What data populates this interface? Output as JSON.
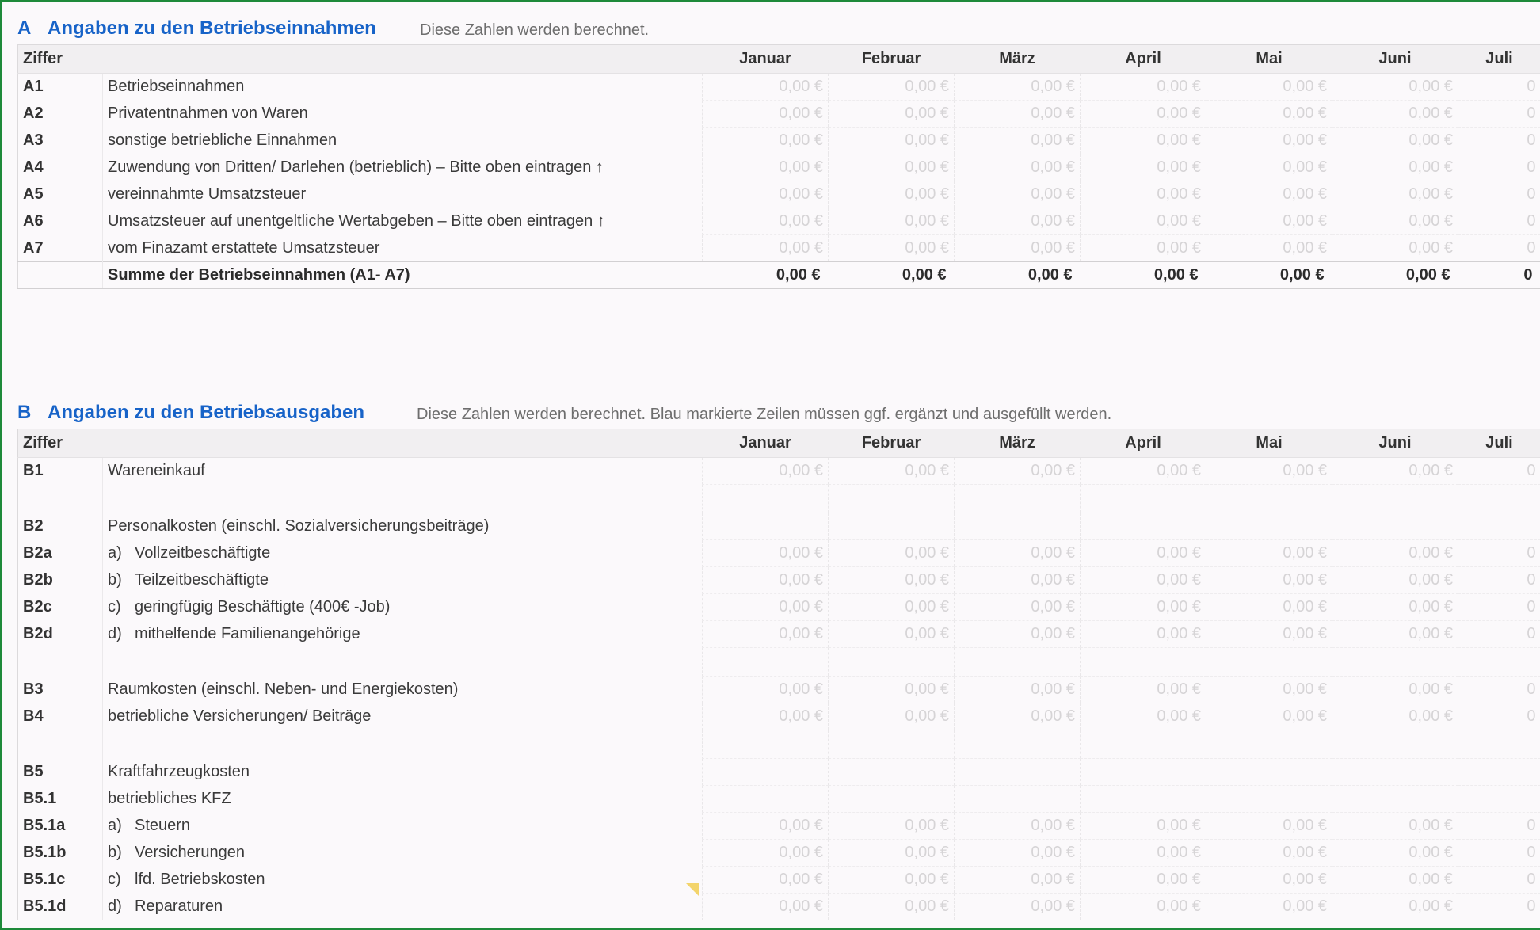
{
  "section_a": {
    "letter": "A",
    "title": "Angaben zu den Betriebseinnahmen",
    "note": "Diese Zahlen werden berechnet.",
    "header_code": "Ziffer",
    "months": [
      "Januar",
      "Februar",
      "März",
      "April",
      "Mai",
      "Juni",
      "Juli"
    ],
    "rows": [
      {
        "code": "A1",
        "sub": "",
        "label": "Betriebseinnahmen",
        "values": [
          "0,00 €",
          "0,00 €",
          "0,00 €",
          "0,00 €",
          "0,00 €",
          "0,00 €",
          "0"
        ]
      },
      {
        "code": "A2",
        "sub": "",
        "label": "Privatentnahmen von Waren",
        "values": [
          "0,00 €",
          "0,00 €",
          "0,00 €",
          "0,00 €",
          "0,00 €",
          "0,00 €",
          "0"
        ]
      },
      {
        "code": "A3",
        "sub": "",
        "label": "sonstige betriebliche Einnahmen",
        "values": [
          "0,00 €",
          "0,00 €",
          "0,00 €",
          "0,00 €",
          "0,00 €",
          "0,00 €",
          "0"
        ]
      },
      {
        "code": "A4",
        "sub": "",
        "label": "Zuwendung von Dritten/ Darlehen (betrieblich) – Bitte oben eintragen ↑",
        "values": [
          "0,00 €",
          "0,00 €",
          "0,00 €",
          "0,00 €",
          "0,00 €",
          "0,00 €",
          "0"
        ]
      },
      {
        "code": "A5",
        "sub": "",
        "label": "vereinnahmte Umsatzsteuer",
        "values": [
          "0,00 €",
          "0,00 €",
          "0,00 €",
          "0,00 €",
          "0,00 €",
          "0,00 €",
          "0"
        ]
      },
      {
        "code": "A6",
        "sub": "",
        "label": "Umsatzsteuer auf unentgeltliche Wertabgeben – Bitte oben eintragen ↑",
        "values": [
          "0,00 €",
          "0,00 €",
          "0,00 €",
          "0,00 €",
          "0,00 €",
          "0,00 €",
          "0"
        ]
      },
      {
        "code": "A7",
        "sub": "",
        "label": "vom Finazamt erstattete Umsatzsteuer",
        "values": [
          "0,00 €",
          "0,00 €",
          "0,00 €",
          "0,00 €",
          "0,00 €",
          "0,00 €",
          "0"
        ]
      }
    ],
    "sum": {
      "label": "Summe der Betriebseinnahmen (A1- A7)",
      "values": [
        "0,00 €",
        "0,00 €",
        "0,00 €",
        "0,00 €",
        "0,00 €",
        "0,00 €",
        "0"
      ]
    }
  },
  "section_b": {
    "letter": "B",
    "title": "Angaben zu den Betriebsausgaben",
    "note": "Diese Zahlen werden berechnet. Blau markierte Zeilen müssen ggf. ergänzt und ausgefüllt werden.",
    "header_code": "Ziffer",
    "months": [
      "Januar",
      "Februar",
      "März",
      "April",
      "Mai",
      "Juni",
      "Juli"
    ],
    "rows": [
      {
        "code": "B1",
        "sub": "",
        "label": "Wareneinkauf",
        "values": [
          "0,00 €",
          "0,00 €",
          "0,00 €",
          "0,00 €",
          "0,00 €",
          "0,00 €",
          "0"
        ]
      },
      {
        "spacer": true
      },
      {
        "code": "B2",
        "sub": "",
        "label": "Personalkosten (einschl. Sozialversicherungsbeiträge)",
        "values": []
      },
      {
        "code": "B2a",
        "sub": "a)",
        "label": "Vollzeitbeschäftigte",
        "values": [
          "0,00 €",
          "0,00 €",
          "0,00 €",
          "0,00 €",
          "0,00 €",
          "0,00 €",
          "0"
        ]
      },
      {
        "code": "B2b",
        "sub": "b)",
        "label": "Teilzeitbeschäftigte",
        "values": [
          "0,00 €",
          "0,00 €",
          "0,00 €",
          "0,00 €",
          "0,00 €",
          "0,00 €",
          "0"
        ]
      },
      {
        "code": "B2c",
        "sub": "c)",
        "label": "geringfügig Beschäftigte (400€ -Job)",
        "values": [
          "0,00 €",
          "0,00 €",
          "0,00 €",
          "0,00 €",
          "0,00 €",
          "0,00 €",
          "0"
        ]
      },
      {
        "code": "B2d",
        "sub": "d)",
        "label": "mithelfende Familienangehörige",
        "values": [
          "0,00 €",
          "0,00 €",
          "0,00 €",
          "0,00 €",
          "0,00 €",
          "0,00 €",
          "0"
        ]
      },
      {
        "spacer": true
      },
      {
        "code": "B3",
        "sub": "",
        "label": "Raumkosten (einschl. Neben- und Energiekosten)",
        "values": [
          "0,00 €",
          "0,00 €",
          "0,00 €",
          "0,00 €",
          "0,00 €",
          "0,00 €",
          "0"
        ]
      },
      {
        "code": "B4",
        "sub": "",
        "label": "betriebliche Versicherungen/ Beiträge",
        "values": [
          "0,00 €",
          "0,00 €",
          "0,00 €",
          "0,00 €",
          "0,00 €",
          "0,00 €",
          "0"
        ]
      },
      {
        "spacer": true
      },
      {
        "code": "B5",
        "sub": "",
        "label": "Kraftfahrzeugkosten",
        "values": []
      },
      {
        "code": "B5.1",
        "sub": "",
        "label": "betriebliches  KFZ",
        "values": []
      },
      {
        "code": "B5.1a",
        "sub": "a)",
        "label": "Steuern",
        "values": [
          "0,00 €",
          "0,00 €",
          "0,00 €",
          "0,00 €",
          "0,00 €",
          "0,00 €",
          "0"
        ]
      },
      {
        "code": "B5.1b",
        "sub": "b)",
        "label": "Versicherungen",
        "values": [
          "0,00 €",
          "0,00 €",
          "0,00 €",
          "0,00 €",
          "0,00 €",
          "0,00 €",
          "0"
        ]
      },
      {
        "code": "B5.1c",
        "sub": "c)",
        "label": "lfd. Betriebskosten",
        "values": [
          "0,00 €",
          "0,00 €",
          "0,00 €",
          "0,00 €",
          "0,00 €",
          "0,00 €",
          "0"
        ]
      },
      {
        "code": "B5.1d",
        "sub": "d)",
        "label": "Reparaturen",
        "values": [
          "0,00 €",
          "0,00 €",
          "0,00 €",
          "0,00 €",
          "0,00 €",
          "0,00 €",
          "0"
        ]
      }
    ]
  }
}
